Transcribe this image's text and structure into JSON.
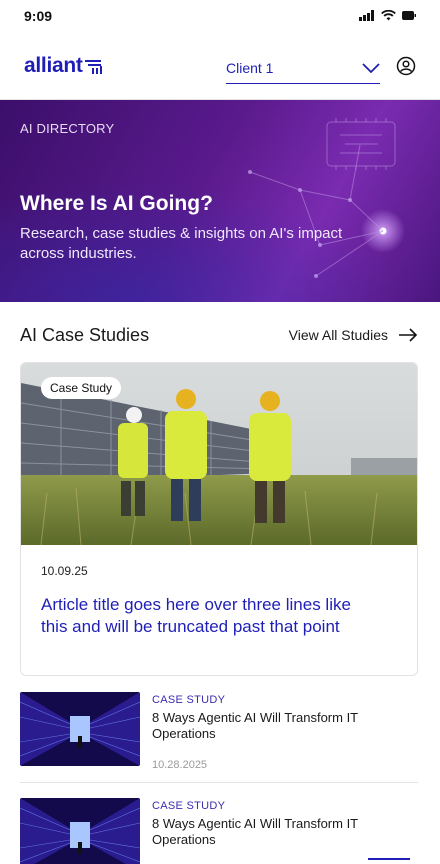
{
  "status_bar": {
    "time": "9:09"
  },
  "header": {
    "brand": "alliant",
    "client_select": "Client 1"
  },
  "hero": {
    "eyebrow": "AI DIRECTORY",
    "title": "Where Is AI Going?",
    "subtitle": "Research, case studies & insights on AI's impact across industries."
  },
  "case_studies": {
    "section_title": "AI Case Studies",
    "view_all": "View All Studies",
    "featured": {
      "badge": "Case Study",
      "date": "10.09.25",
      "title": "Article title goes here over three lines like this and will be truncated past that point"
    },
    "items": [
      {
        "eyebrow": "CASE STUDY",
        "title": "8 Ways Agentic AI Will Transform IT Operations",
        "date": "10.28.2025"
      },
      {
        "eyebrow": "CASE STUDY",
        "title": "8 Ways Agentic AI Will Transform IT Operations",
        "date": ""
      }
    ]
  },
  "colors": {
    "brand": "#1f1fb8",
    "hero_purple": "#5a1a8c"
  }
}
